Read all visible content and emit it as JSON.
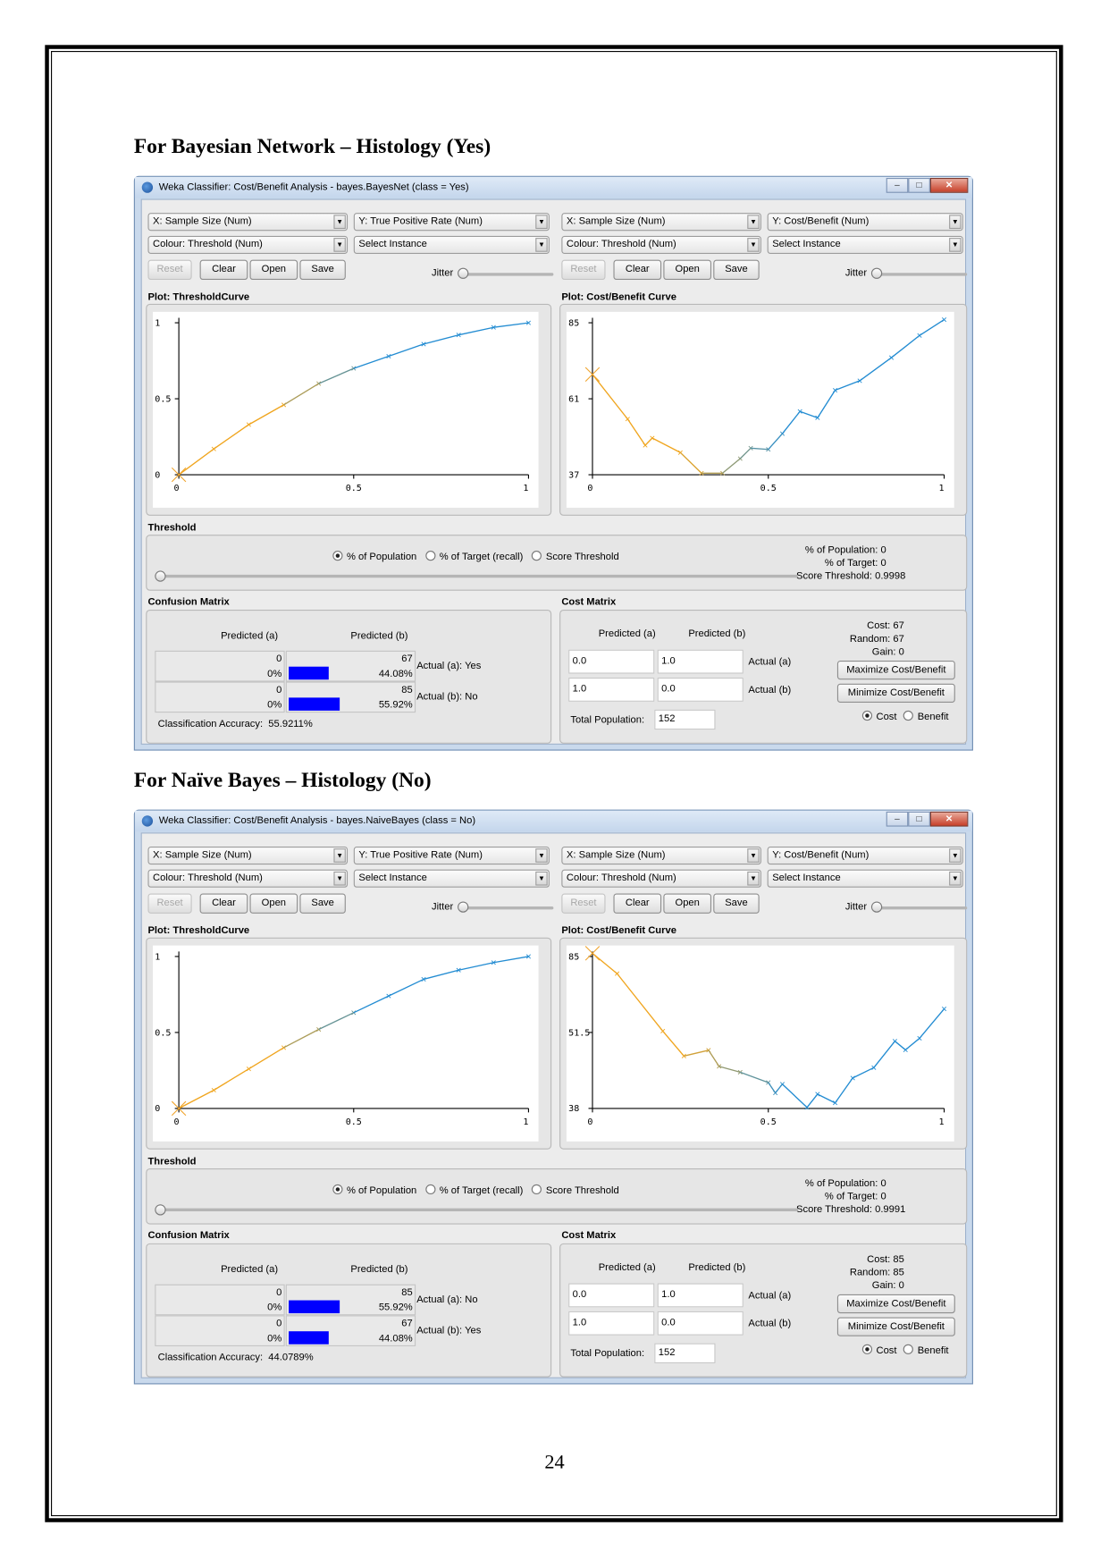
{
  "page_number": "24",
  "windows": [
    {
      "heading": "For Bayesian Network – Histology (Yes)",
      "title": "Weka Classifier: Cost/Benefit Analysis - bayes.BayesNet  (class = Yes)",
      "left": {
        "x_axis": "X: Sample Size (Num)",
        "y_axis": "Y: True Positive Rate (Num)",
        "colour": "Colour: Threshold (Num)",
        "select": "Select Instance",
        "buttons": [
          "Reset",
          "Clear",
          "Open",
          "Save"
        ],
        "jitter": "Jitter",
        "plot_label": "Plot: ThresholdCurve"
      },
      "right": {
        "x_axis": "X: Sample Size (Num)",
        "y_axis": "Y: Cost/Benefit (Num)",
        "colour": "Colour: Threshold (Num)",
        "select": "Select Instance",
        "buttons": [
          "Reset",
          "Clear",
          "Open",
          "Save"
        ],
        "jitter": "Jitter",
        "plot_label": "Plot: Cost/Benefit Curve"
      },
      "threshold_plot": {
        "type": "line",
        "ylim": [
          0,
          1
        ],
        "xticks": [
          "0",
          "0.5",
          "1"
        ],
        "yticks": [
          "1",
          "0.5",
          "0"
        ],
        "x": [
          0,
          0.1,
          0.2,
          0.3,
          0.4,
          0.5,
          0.6,
          0.7,
          0.8,
          0.9,
          1
        ],
        "y": [
          0,
          0.17,
          0.33,
          0.46,
          0.6,
          0.7,
          0.78,
          0.86,
          0.92,
          0.97,
          1
        ]
      },
      "cost_plot": {
        "type": "line",
        "ylim": [
          37,
          85
        ],
        "xticks": [
          "0",
          "0.5",
          "1"
        ],
        "yticks": [
          "85",
          "61",
          "37"
        ],
        "x": [
          0,
          0.1,
          0.15,
          0.17,
          0.25,
          0.31,
          0.37,
          0.42,
          0.45,
          0.5,
          0.54,
          0.59,
          0.64,
          0.69,
          0.76,
          0.85,
          0.93,
          1
        ],
        "y": [
          68.7,
          54.6,
          46.3,
          48.6,
          44,
          37.5,
          37.5,
          42.1,
          45.4,
          45,
          50,
          57,
          55,
          63.7,
          66.7,
          74,
          81,
          86
        ]
      },
      "threshold": {
        "label": "Threshold",
        "radios": [
          "% of Population",
          "% of Target (recall)",
          "Score Threshold"
        ],
        "selected": 0,
        "population": "% of Population: 0",
        "target": "% of Target: 0",
        "score": "Score Threshold: 0.9998",
        "slider_value": 0
      },
      "confusion": {
        "label": "Confusion Matrix",
        "pred_a": "Predicted (a)",
        "pred_b": "Predicted (b)",
        "rows": [
          {
            "a_count": "0",
            "a_pct": "0%",
            "b_count": "67",
            "b_pct": "44.08%",
            "b_frac": 0.4408,
            "actual": "Actual (a): Yes"
          },
          {
            "a_count": "0",
            "a_pct": "0%",
            "b_count": "85",
            "b_pct": "55.92%",
            "b_frac": 0.5592,
            "actual": "Actual (b): No"
          }
        ],
        "accuracy_label": "Classification Accuracy:",
        "accuracy": "55.9211%"
      },
      "cost": {
        "label": "Cost Matrix",
        "pred_a": "Predicted (a)",
        "pred_b": "Predicted (b)",
        "m00": "0.0",
        "m01": "1.0",
        "m10": "1.0",
        "m11": "0.0",
        "actual_a": "Actual (a)",
        "actual_b": "Actual (b)",
        "total_label": "Total Population:",
        "total": "152",
        "cost": "Cost: 67",
        "random": "Random: 67",
        "gain": "Gain: 0",
        "max_button": "Maximize Cost/Benefit",
        "min_button": "Minimize Cost/Benefit",
        "radio_cost": "Cost",
        "radio_benefit": "Benefit",
        "selected": "Cost"
      }
    },
    {
      "heading": "For Naïve Bayes – Histology (No)",
      "title": "Weka Classifier: Cost/Benefit Analysis - bayes.NaiveBayes  (class = No)",
      "left": {
        "x_axis": "X: Sample Size (Num)",
        "y_axis": "Y: True Positive Rate (Num)",
        "colour": "Colour: Threshold (Num)",
        "select": "Select Instance",
        "buttons": [
          "Reset",
          "Clear",
          "Open",
          "Save"
        ],
        "jitter": "Jitter",
        "plot_label": "Plot: ThresholdCurve"
      },
      "right": {
        "x_axis": "X: Sample Size (Num)",
        "y_axis": "Y: Cost/Benefit (Num)",
        "colour": "Colour: Threshold (Num)",
        "select": "Select Instance",
        "buttons": [
          "Reset",
          "Clear",
          "Open",
          "Save"
        ],
        "jitter": "Jitter",
        "plot_label": "Plot: Cost/Benefit Curve"
      },
      "threshold_plot": {
        "type": "line",
        "ylim": [
          0,
          1
        ],
        "xticks": [
          "0",
          "0.5",
          "1"
        ],
        "yticks": [
          "1",
          "0.5",
          "0"
        ],
        "x": [
          0,
          0.1,
          0.2,
          0.3,
          0.4,
          0.5,
          0.6,
          0.7,
          0.8,
          0.9,
          1
        ],
        "y": [
          0,
          0.12,
          0.26,
          0.4,
          0.52,
          0.63,
          0.74,
          0.85,
          0.91,
          0.96,
          1
        ]
      },
      "cost_plot": {
        "type": "line",
        "ylim": [
          38,
          85
        ],
        "xticks": [
          "0",
          "0.5",
          "1"
        ],
        "yticks": [
          "85",
          "51.5",
          "38"
        ],
        "x": [
          0,
          0.07,
          0.2,
          0.26,
          0.33,
          0.36,
          0.42,
          0.5,
          0.52,
          0.54,
          0.61,
          0.64,
          0.69,
          0.74,
          0.8,
          0.86,
          0.89,
          0.93,
          1
        ],
        "y": [
          86,
          79.7,
          61.9,
          54.2,
          56,
          51,
          49.2,
          46,
          42.8,
          45.5,
          38.3,
          42.4,
          39.7,
          47.4,
          50.6,
          58.8,
          56.1,
          59.7,
          68.8
        ]
      },
      "threshold": {
        "label": "Threshold",
        "radios": [
          "% of Population",
          "% of Target (recall)",
          "Score Threshold"
        ],
        "selected": 0,
        "population": "% of Population: 0",
        "target": "% of Target: 0",
        "score": "Score Threshold: 0.9991",
        "slider_value": 0
      },
      "confusion": {
        "label": "Confusion Matrix",
        "pred_a": "Predicted (a)",
        "pred_b": "Predicted (b)",
        "rows": [
          {
            "a_count": "0",
            "a_pct": "0%",
            "b_count": "85",
            "b_pct": "55.92%",
            "b_frac": 0.5592,
            "actual": "Actual (a): No"
          },
          {
            "a_count": "0",
            "a_pct": "0%",
            "b_count": "67",
            "b_pct": "44.08%",
            "b_frac": 0.4408,
            "actual": "Actual (b): Yes"
          }
        ],
        "accuracy_label": "Classification Accuracy:",
        "accuracy": "44.0789%"
      },
      "cost": {
        "label": "Cost Matrix",
        "pred_a": "Predicted (a)",
        "pred_b": "Predicted (b)",
        "m00": "0.0",
        "m01": "1.0",
        "m10": "1.0",
        "m11": "0.0",
        "actual_a": "Actual (a)",
        "actual_b": "Actual (b)",
        "total_label": "Total Population:",
        "total": "152",
        "cost": "Cost: 85",
        "random": "Random: 85",
        "gain": "Gain: 0",
        "max_button": "Maximize Cost/Benefit",
        "min_button": "Minimize Cost/Benefit",
        "radio_cost": "Cost",
        "radio_benefit": "Benefit",
        "selected": "Cost"
      }
    }
  ]
}
